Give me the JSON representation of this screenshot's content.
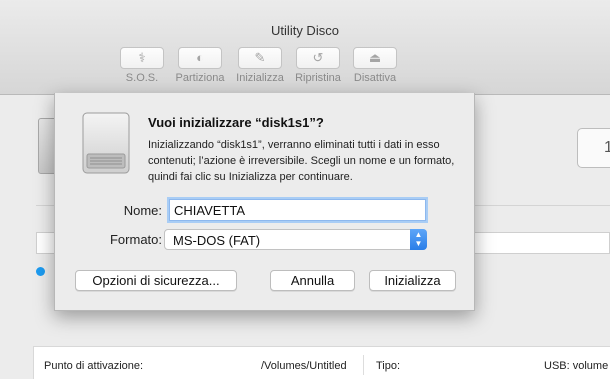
{
  "window": {
    "title": "Utility Disco"
  },
  "toolbar": {
    "items": [
      {
        "label": "S.O.S.",
        "icon": "stethoscope-icon",
        "glyph": "⚕"
      },
      {
        "label": "Partiziona",
        "icon": "partition-pie-icon",
        "glyph": "◐"
      },
      {
        "label": "Inizializza",
        "icon": "erase-icon",
        "glyph": "✎"
      },
      {
        "label": "Ripristina",
        "icon": "restore-icon",
        "glyph": "↺"
      },
      {
        "label": "Disattiva",
        "icon": "unmount-icon",
        "glyph": "⏏"
      }
    ]
  },
  "background": {
    "right_box_text": "1",
    "info": {
      "mount_label": "Punto di attivazione:",
      "mount_value": "/Volumes/Untitled",
      "type_label": "Tipo:",
      "type_value": "USB: volume"
    }
  },
  "dialog": {
    "title": "Vuoi inizializzare “disk1s1”?",
    "message": "Inizializzando “disk1s1”, verranno eliminati tutti i dati in esso contenuti; l’azione è irreversibile. Scegli un nome e un formato, quindi fai clic su Inizializza per continuare.",
    "name_label": "Nome:",
    "name_value": "CHIAVETTA",
    "format_label": "Formato:",
    "format_value": "MS-DOS (FAT)",
    "security_button": "Opzioni di sicurezza...",
    "cancel_button": "Annulla",
    "erase_button": "Inizializza"
  },
  "colors": {
    "accent": "#2a7ee8",
    "focus_ring": "#a9cdf5",
    "status_dot": "#1d9bf0"
  }
}
